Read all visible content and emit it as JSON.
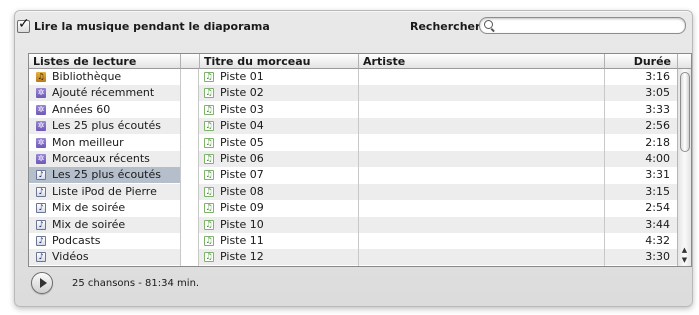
{
  "top": {
    "play_music_label": "Lire la musique pendant le diaporama",
    "play_music_checked": true,
    "search_label": "Rechercher :",
    "search_value": ""
  },
  "playlists": {
    "header": "Listes de lecture",
    "selected_index": 6,
    "items": [
      {
        "label": "Bibliothèque",
        "icon": "library-icon"
      },
      {
        "label": "Ajouté récemment",
        "icon": "smart-playlist-icon"
      },
      {
        "label": "Années 60",
        "icon": "smart-playlist-icon"
      },
      {
        "label": "Les 25 plus écoutés",
        "icon": "smart-playlist-icon"
      },
      {
        "label": "Mon meilleur",
        "icon": "smart-playlist-icon"
      },
      {
        "label": "Morceaux récents",
        "icon": "smart-playlist-icon"
      },
      {
        "label": "Les 25 plus écoutés",
        "icon": "playlist-icon"
      },
      {
        "label": "Liste iPod de Pierre",
        "icon": "playlist-icon"
      },
      {
        "label": "Mix de soirée",
        "icon": "playlist-icon"
      },
      {
        "label": "Mix de soirée",
        "icon": "playlist-icon"
      },
      {
        "label": "Podcasts",
        "icon": "playlist-icon"
      },
      {
        "label": "Vidéos",
        "icon": "playlist-icon"
      }
    ]
  },
  "tracks": {
    "columns": {
      "title": "Titre du morceau",
      "artist": "Artiste",
      "duration": "Durée"
    },
    "rows": [
      {
        "title": "Piste 01",
        "artist": "",
        "duration": "3:16"
      },
      {
        "title": "Piste 02",
        "artist": "",
        "duration": "3:05"
      },
      {
        "title": "Piste 03",
        "artist": "",
        "duration": "3:33"
      },
      {
        "title": "Piste 04",
        "artist": "",
        "duration": "2:56"
      },
      {
        "title": "Piste 05",
        "artist": "",
        "duration": "2:18"
      },
      {
        "title": "Piste 06",
        "artist": "",
        "duration": "4:00"
      },
      {
        "title": "Piste 07",
        "artist": "",
        "duration": "3:31"
      },
      {
        "title": "Piste 08",
        "artist": "",
        "duration": "3:15"
      },
      {
        "title": "Piste 09",
        "artist": "",
        "duration": "2:54"
      },
      {
        "title": "Piste 10",
        "artist": "",
        "duration": "3:44"
      },
      {
        "title": "Piste 11",
        "artist": "",
        "duration": "4:32"
      },
      {
        "title": "Piste 12",
        "artist": "",
        "duration": "3:30"
      }
    ]
  },
  "footer": {
    "summary": "25 chansons - 81:34 min."
  },
  "colors": {
    "selected_row": "#b5bfcc",
    "alt_row": "#ededed",
    "panel": "#e2e2e2"
  }
}
